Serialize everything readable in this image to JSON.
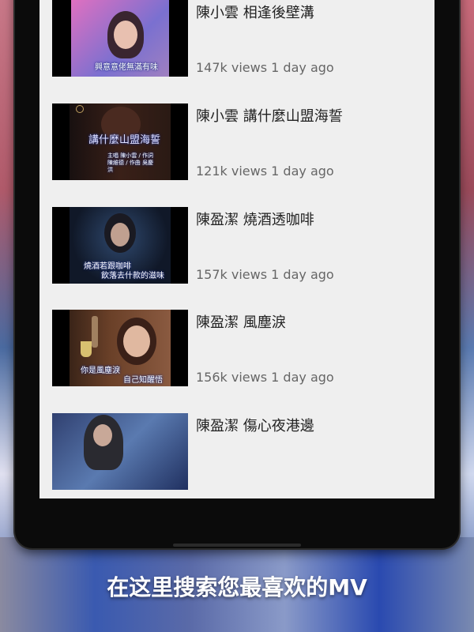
{
  "videos": [
    {
      "title": "陳小雲 相逢後壁溝",
      "meta": "147k views 1 day ago",
      "overlay": "興意意佬無滿有味"
    },
    {
      "title": "陳小雲 講什麼山盟海誓",
      "meta": "121k views 1 day ago",
      "overlay": "講什麼山盟海誓",
      "credits": "主唱 陳小雲 / 作詞 陳維德 / 作曲 吳慶洪"
    },
    {
      "title": "陳盈潔 燒酒透咖啡",
      "meta": "157k views 1 day ago",
      "overlay": "燒酒若跟咖啡",
      "overlay2": "飲落去什款的滋味"
    },
    {
      "title": "陳盈潔 風塵淚",
      "meta": "156k views 1 day ago",
      "overlay": "你是風塵淚",
      "overlay2": "自己知醒悟"
    },
    {
      "title": "陳盈潔 傷心夜港邊",
      "meta": ""
    }
  ],
  "promo": {
    "tagline": "在这里搜索您最喜欢的MV"
  },
  "colors": {
    "screen_bg": "#efefef",
    "device": "#0b0b0b",
    "title_text": "#222222",
    "meta_text": "#666666"
  }
}
